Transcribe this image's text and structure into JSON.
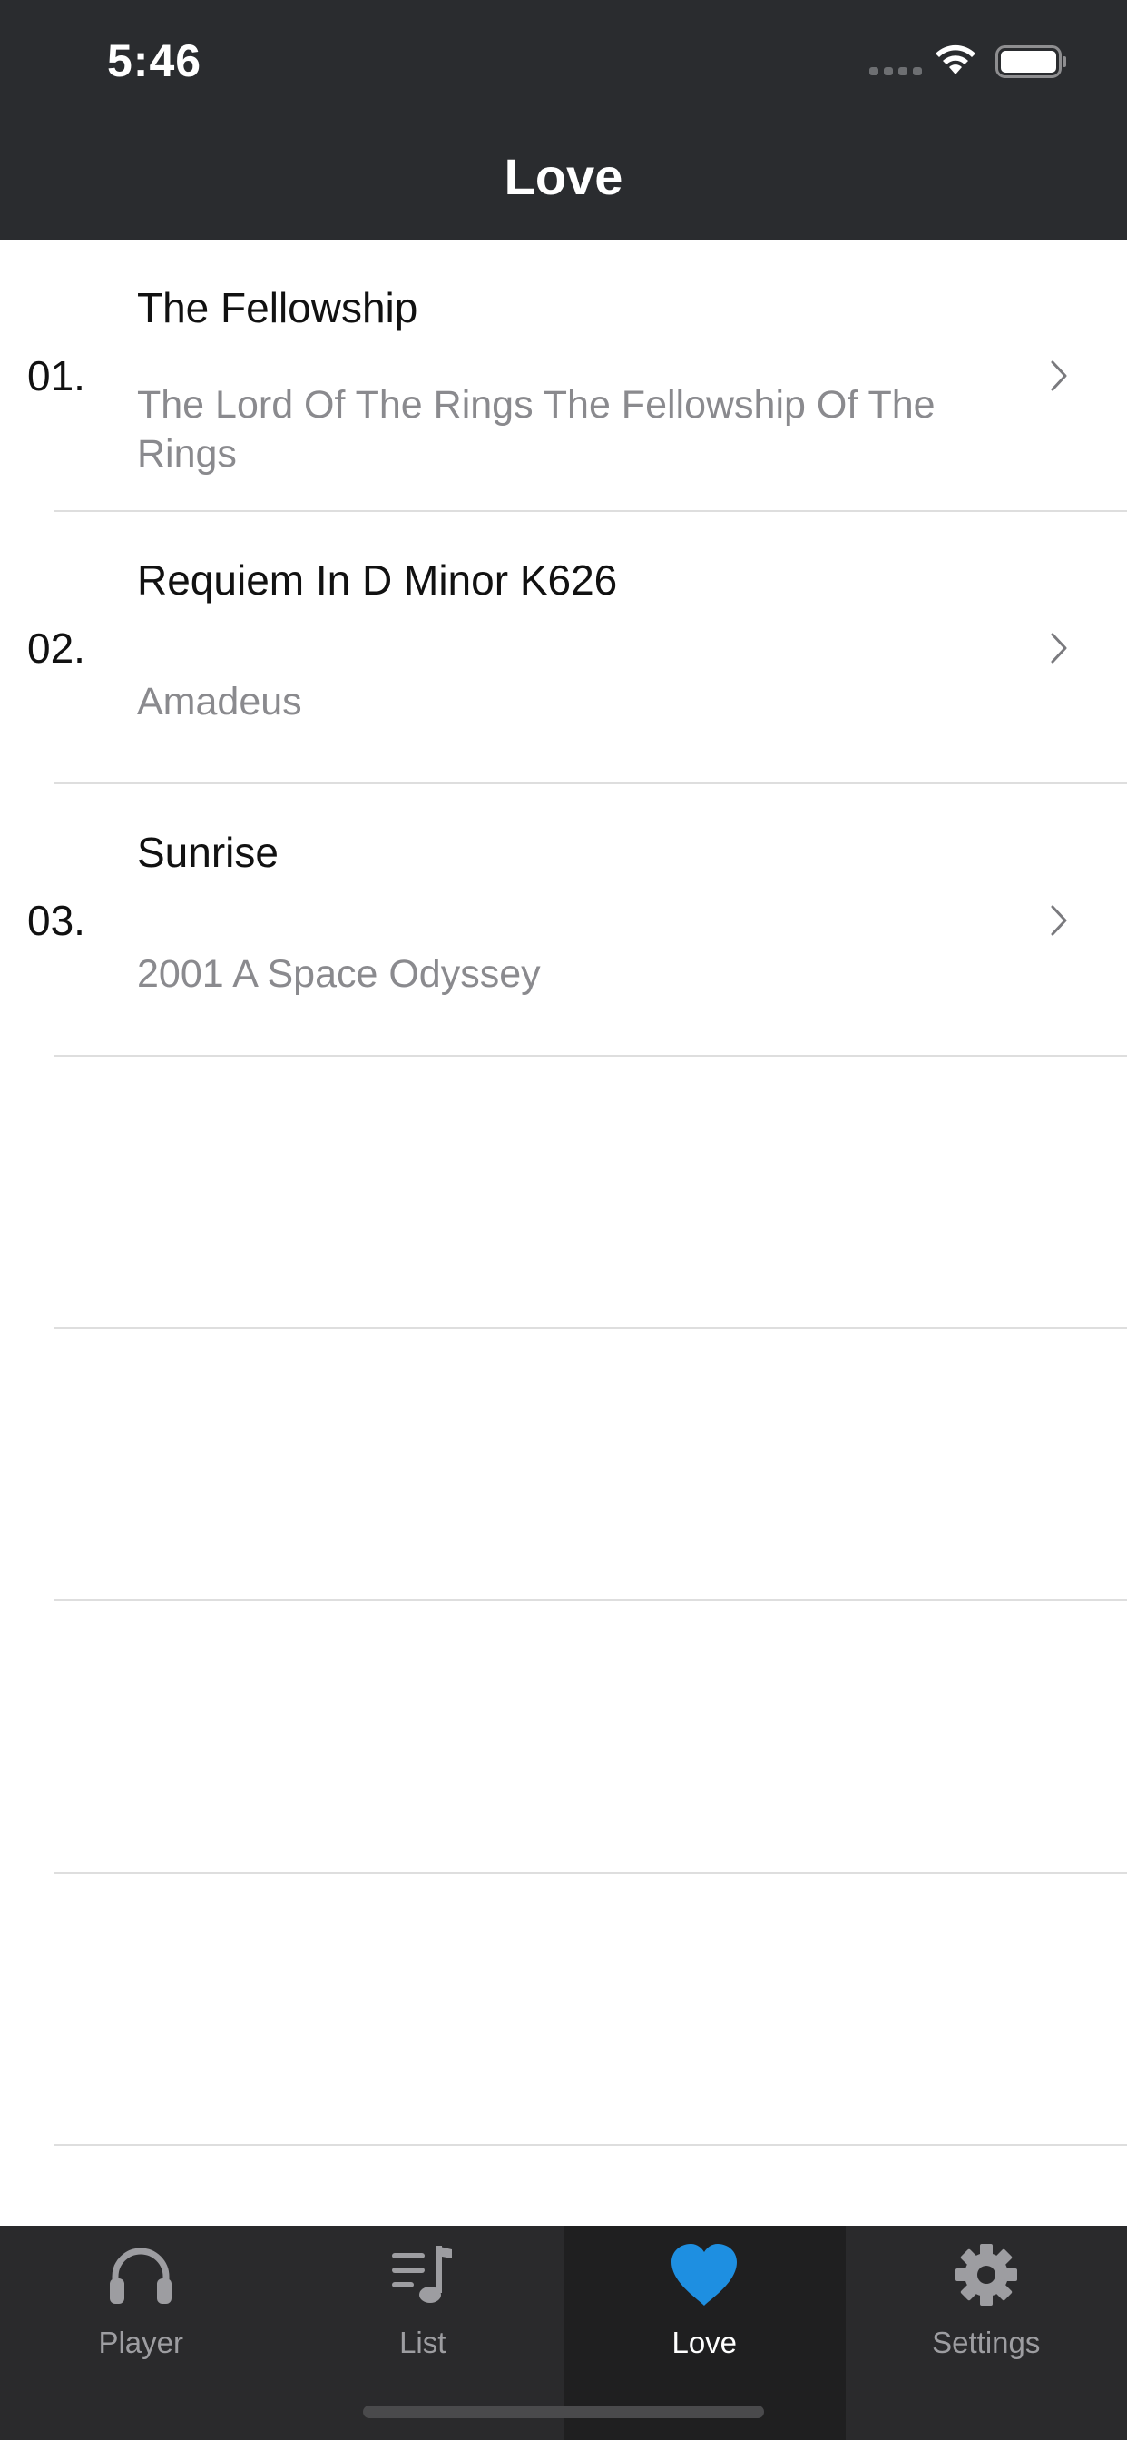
{
  "status_bar": {
    "time": "5:46"
  },
  "nav": {
    "title": "Love"
  },
  "tracks": [
    {
      "number": "01.",
      "title": "The Fellowship",
      "subtitle": "The Lord Of The Rings The Fellowship Of The Rings"
    },
    {
      "number": "02.",
      "title": "Requiem In D Minor K626",
      "subtitle": "Amadeus"
    },
    {
      "number": "03.",
      "title": "Sunrise",
      "subtitle": "2001 A Space Odyssey"
    }
  ],
  "tabs": [
    {
      "label": "Player",
      "icon": "headphones-icon"
    },
    {
      "label": "List",
      "icon": "music-list-icon"
    },
    {
      "label": "Love",
      "icon": "heart-icon",
      "active": true
    },
    {
      "label": "Settings",
      "icon": "gear-icon"
    }
  ],
  "colors": {
    "bar_background": "#2a2c2f",
    "active_tab_accent": "#1e8fe1",
    "subtitle_gray": "#8a8a8e"
  }
}
